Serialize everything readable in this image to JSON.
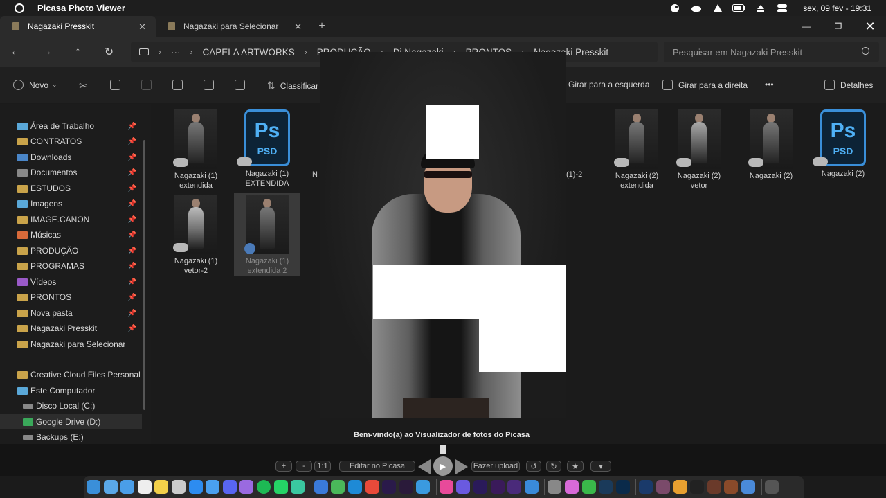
{
  "menubar": {
    "app_name": "Picasa Photo Viewer",
    "clock": "sex, 09 fev - 19:31",
    "status_icons": [
      "steam-icon",
      "cloud-sync-icon",
      "drive-icon",
      "battery-icon",
      "eject-icon",
      "control-center-icon"
    ]
  },
  "tabs": [
    {
      "label": "Nagazaki Presskit",
      "active": true
    },
    {
      "label": "Nagazaki para Selecionar",
      "active": false
    }
  ],
  "address": {
    "crumbs": [
      "CAPELA ARTWORKS",
      "PRODUÇÃO",
      "Dj Nagazaki",
      "PRONTOS",
      "Nagazaki Presskit"
    ],
    "search_placeholder": "Pesquisar em Nagazaki Presskit"
  },
  "commands": {
    "new": "Novo",
    "sort": "Classificar",
    "rotate_left": "Girar para a esquerda",
    "rotate_right": "Girar para a direita",
    "more": "•••",
    "details": "Detalhes"
  },
  "sidebar": {
    "pinned": [
      {
        "label": "Área de Trabalho",
        "icon": "desktop-icon"
      },
      {
        "label": "CONTRATOS",
        "icon": "folder-icon"
      },
      {
        "label": "Downloads",
        "icon": "download-icon"
      },
      {
        "label": "Documentos",
        "icon": "documents-icon"
      },
      {
        "label": "ESTUDOS",
        "icon": "folder-icon"
      },
      {
        "label": "Imagens",
        "icon": "pictures-icon"
      },
      {
        "label": "IMAGE.CANON",
        "icon": "folder-icon"
      },
      {
        "label": "Músicas",
        "icon": "music-icon"
      },
      {
        "label": "PRODUÇÃO",
        "icon": "folder-icon"
      },
      {
        "label": "PROGRAMAS",
        "icon": "folder-icon"
      },
      {
        "label": "Vídeos",
        "icon": "videos-icon"
      },
      {
        "label": "PRONTOS",
        "icon": "folder-icon"
      },
      {
        "label": "Nova pasta",
        "icon": "folder-icon"
      },
      {
        "label": "Nagazaki Presskit",
        "icon": "folder-icon"
      },
      {
        "label": "Nagazaki para Selecionar",
        "icon": "folder-icon"
      }
    ],
    "locations": [
      {
        "label": "Creative Cloud Files Personal Ac",
        "icon": "folder-icon"
      },
      {
        "label": "Este Computador",
        "icon": "computer-icon"
      },
      {
        "label": "Disco Local (C:)",
        "icon": "drive-icon"
      },
      {
        "label": "Google Drive (D:)",
        "icon": "google-drive-icon"
      },
      {
        "label": "Backups (E:)",
        "icon": "drive-icon"
      }
    ]
  },
  "files": [
    {
      "line1": "Nagazaki (1)",
      "line2": "extendida",
      "type": "image"
    },
    {
      "line1": "Nagazaki (1)",
      "line2": "EXTENDIDA",
      "type": "psd"
    },
    {
      "line1": "N",
      "line2": "",
      "type": "image"
    },
    {
      "line1": "(1)-2",
      "line2": "",
      "type": "image"
    },
    {
      "line1": "Nagazaki (2)",
      "line2": "extendida",
      "type": "image"
    },
    {
      "line1": "Nagazaki (2)",
      "line2": "vetor",
      "type": "image"
    },
    {
      "line1": "Nagazaki (2)",
      "line2": "",
      "type": "image"
    },
    {
      "line1": "Nagazaki (2)",
      "line2": "",
      "type": "psd"
    },
    {
      "line1": "Nagazaki (1)",
      "line2": "vetor-2",
      "type": "image"
    },
    {
      "line1": "Nagazaki (1)",
      "line2": "extendida 2",
      "type": "image"
    }
  ],
  "psd_badge": {
    "ps": "Ps",
    "ext": "PSD"
  },
  "viewer": {
    "welcome": "Bem-vindo(a) ao Visualizador de fotos do Picasa",
    "zoom_in": "+",
    "zoom_out": "-",
    "one_to_one": "1:1",
    "edit": "Editar no Picasa",
    "upload": "Fazer upload",
    "star": "★",
    "more": "▾"
  },
  "window_controls": {
    "minimize": "—",
    "maximize": "❐",
    "close": "✕"
  },
  "colors": {
    "accent_psd": "#3a8fd9",
    "folder": "#c9a34a"
  }
}
